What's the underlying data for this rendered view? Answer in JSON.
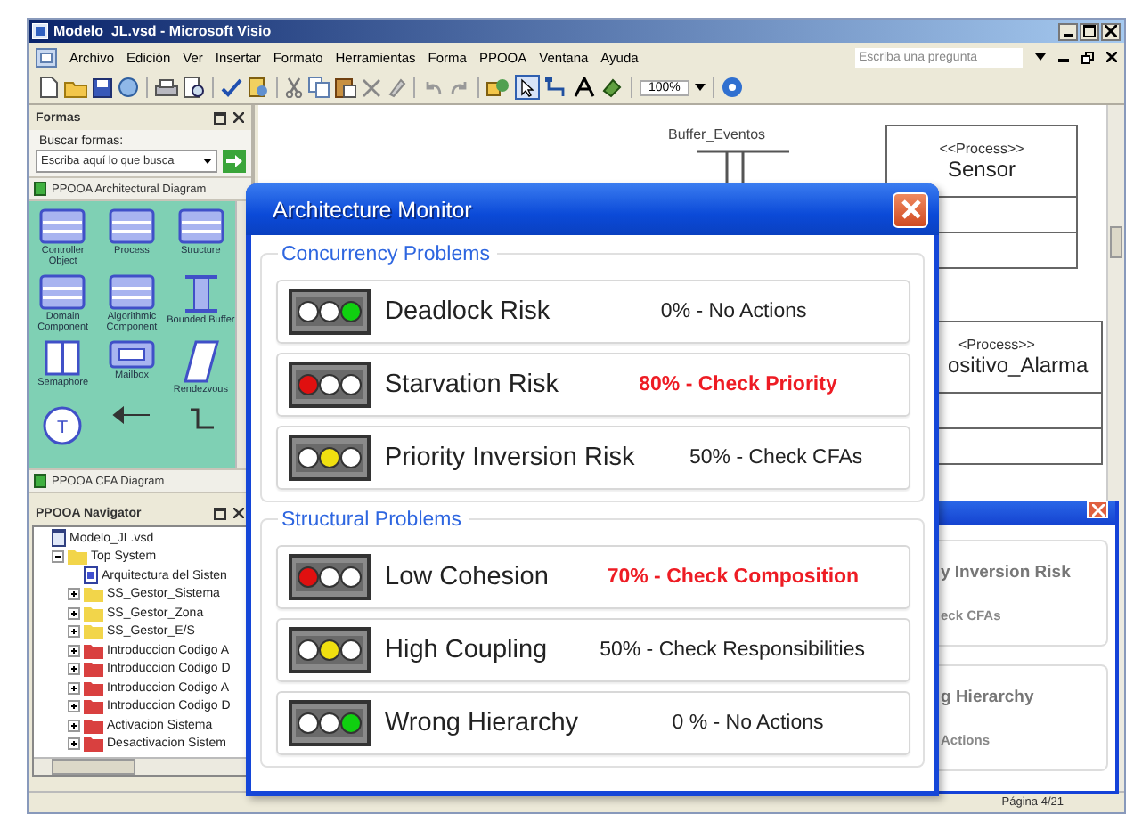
{
  "window": {
    "title": "Modelo_JL.vsd - Microsoft Visio"
  },
  "menu": [
    "Archivo",
    "Edición",
    "Ver",
    "Insertar",
    "Formato",
    "Herramientas",
    "Forma",
    "PPOOA",
    "Ventana",
    "Ayuda"
  ],
  "help_search": {
    "placeholder": "Escriba una pregunta"
  },
  "toolbar": {
    "zoom": "100%"
  },
  "shapes_panel": {
    "title": "Formas",
    "search_label": "Buscar formas:",
    "search_placeholder": "Escriba aquí lo que busca",
    "stencil": {
      "title": "PPOOA Architectural Diagram",
      "shapes": [
        {
          "kind": "box",
          "label": "Controller Object"
        },
        {
          "kind": "box",
          "label": "Process"
        },
        {
          "kind": "box",
          "label": "Structure"
        },
        {
          "kind": "box",
          "label": "Domain Component"
        },
        {
          "kind": "box",
          "label": "Algorithmic Component"
        },
        {
          "kind": "buffer",
          "label": "Bounded Buffer"
        },
        {
          "kind": "semaphore",
          "label": "Semaphore"
        },
        {
          "kind": "mailbox",
          "label": "Mailbox"
        },
        {
          "kind": "rendezvous",
          "label": "Rendezvous"
        },
        {
          "kind": "circle",
          "glyph": "T"
        },
        {
          "kind": "arrow"
        },
        {
          "kind": "connector"
        }
      ]
    },
    "second_stencil": "PPOOA CFA Diagram"
  },
  "navigator": {
    "title": "PPOOA Navigator",
    "tree": [
      {
        "label": "Modelo_JL.vsd",
        "kind": "file",
        "children": [
          {
            "label": "Top System",
            "kind": "folder",
            "color": "#f2d54a",
            "expanded": true,
            "children": [
              {
                "label": "Arquitectura del Sisten",
                "kind": "diagram"
              },
              {
                "label": "SS_Gestor_Sistema",
                "kind": "folder",
                "color": "#f2d54a",
                "expanded": false
              },
              {
                "label": "SS_Gestor_Zona",
                "kind": "folder",
                "color": "#f2d54a",
                "expanded": false
              },
              {
                "label": "SS_Gestor_E/S",
                "kind": "folder",
                "color": "#f2d54a",
                "expanded": false
              },
              {
                "label": "Introduccion Codigo A",
                "kind": "folder",
                "color": "#d9403f",
                "expanded": false
              },
              {
                "label": "Introduccion Codigo D",
                "kind": "folder",
                "color": "#d9403f",
                "expanded": false
              },
              {
                "label": "Introduccion Codigo A",
                "kind": "folder",
                "color": "#d9403f",
                "expanded": false
              },
              {
                "label": "Introduccion Codigo D",
                "kind": "folder",
                "color": "#d9403f",
                "expanded": false
              },
              {
                "label": "Activacion Sistema",
                "kind": "folder",
                "color": "#d9403f",
                "expanded": false
              },
              {
                "label": "Desactivacion Sistem",
                "kind": "folder",
                "color": "#d9403f",
                "expanded": false
              }
            ]
          }
        ]
      }
    ]
  },
  "diagram": {
    "buffer_label": "Buffer_Eventos",
    "processes": [
      {
        "stereotype": "<<Process>>",
        "name": "Sensor"
      },
      {
        "stereotype": "<Process>>",
        "name": "ositivo_Alarma"
      }
    ]
  },
  "status_bar": {
    "page": "Página 4/21"
  },
  "monitor": {
    "title": "Architecture Monitor",
    "groups": [
      {
        "title": "Concurrency Problems",
        "items": [
          {
            "label": "Deadlock Risk",
            "lit": [
              false,
              false,
              true
            ],
            "status": "0% - No Actions",
            "alert": false
          },
          {
            "label": "Starvation Risk",
            "lit": [
              true,
              false,
              false
            ],
            "status": "80% - Check Priority",
            "alert": true
          },
          {
            "label": "Priority Inversion Risk",
            "lit": [
              false,
              true,
              false
            ],
            "status": "50% - Check CFAs",
            "alert": false
          }
        ]
      },
      {
        "title": "Structural Problems",
        "items": [
          {
            "label": "Low Cohesion",
            "lit": [
              true,
              false,
              false
            ],
            "status": "70% - Check Composition",
            "alert": true
          },
          {
            "label": "High Coupling",
            "lit": [
              false,
              true,
              false
            ],
            "status": "50% -  Check Responsibilities",
            "alert": false
          },
          {
            "label": "Wrong Hierarchy",
            "lit": [
              false,
              false,
              true
            ],
            "status": "0 % - No Actions",
            "alert": false
          }
        ]
      }
    ]
  },
  "back_dialog": {
    "items": [
      {
        "label": "y Inversion Risk",
        "status": "eck CFAs"
      },
      {
        "label": "g Hierarchy",
        "status": "Actions"
      }
    ]
  }
}
